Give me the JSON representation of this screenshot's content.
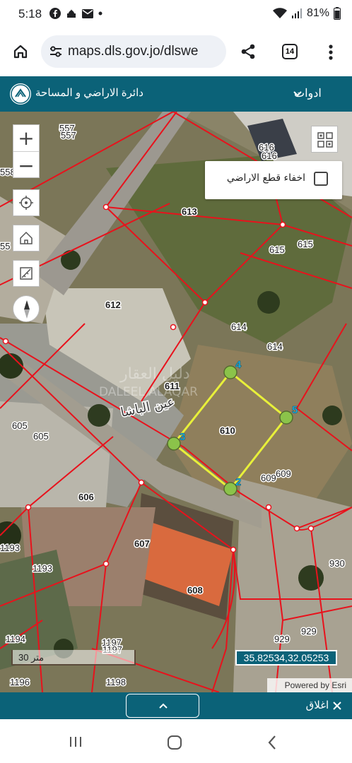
{
  "status_bar": {
    "time": "5:18",
    "battery": "81%",
    "notification_icons": [
      "facebook-icon",
      "mosque-icon",
      "mail-icon",
      "dot-icon"
    ]
  },
  "browser": {
    "url": "maps.dls.gov.jo/dlswe",
    "tab_count": "14",
    "icons": [
      "home-icon",
      "site-settings-icon",
      "share-icon",
      "tabs-icon",
      "more-icon"
    ]
  },
  "app_header": {
    "tools_label": "ادوات",
    "title": "دائرة الاراضي و المساحة"
  },
  "map": {
    "hide_parcels_label": "اخفاء قطع الاراضي",
    "hide_parcels_checked": false,
    "parcel_labels": [
      "557",
      "557",
      "558",
      "616",
      "616",
      "613",
      "615",
      "615",
      "55",
      "612",
      "614",
      "614",
      "611",
      "610",
      "605",
      "605",
      "609",
      "609",
      "606",
      "607",
      "608",
      "1193",
      "1193",
      "930",
      "929",
      "929",
      "1194",
      "1197",
      "1197",
      "1196",
      "1198"
    ],
    "vertex_labels": [
      "4",
      "5",
      "3",
      "2"
    ],
    "watermark": "دليل العقار",
    "watermark_latin": "DALEEL ALAQAR",
    "place_label": "عين الباشا",
    "scale_label": "30 متر",
    "coordinates": "35.82534,32.05253",
    "attribution": "Powered by Esri",
    "colors": {
      "parcel_line": "#e8121c",
      "selection_line": "#e8f03a",
      "vertex_fill": "#8bc34a",
      "vertex_label": "#1fb5e8"
    }
  },
  "bottom_bar": {
    "close_label": "اغلاق",
    "expand_icon": "chevron-up-icon"
  },
  "nav_bar": {
    "icons": [
      "recents-icon",
      "home-nav-icon",
      "back-icon"
    ]
  }
}
